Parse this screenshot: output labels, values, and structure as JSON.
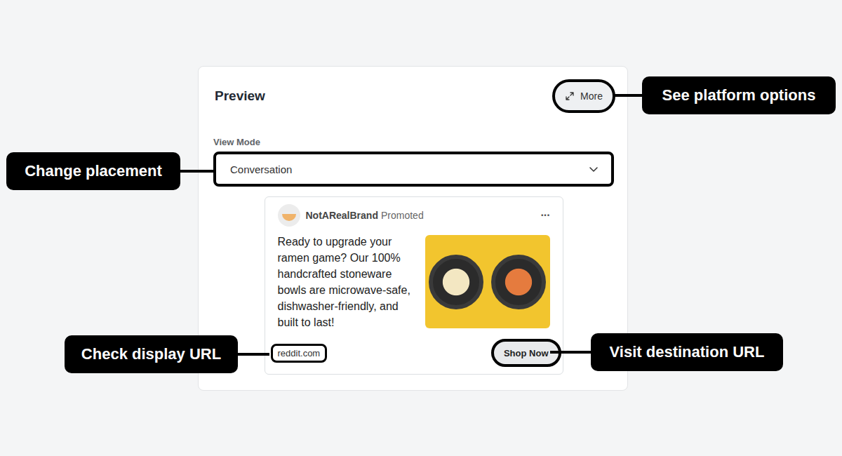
{
  "preview": {
    "title": "Preview",
    "more_button": "More",
    "view_mode_label": "View Mode",
    "view_mode_value": "Conversation"
  },
  "ad": {
    "brand": "NotARealBrand",
    "tag": "Promoted",
    "menu": "···",
    "body": "Ready to upgrade your ramen game? Our 100% handcrafted stoneware bowls are microwave-safe, dishwasher-friendly, and built to last!",
    "display_url": "reddit.com",
    "cta": "Shop Now"
  },
  "annotations": [
    {
      "label": "See platform options",
      "target": "more"
    },
    {
      "label": "Change placement",
      "target": "view-mode"
    },
    {
      "label": "Check display URL",
      "target": "display-url"
    },
    {
      "label": "Visit destination URL",
      "target": "cta"
    }
  ]
}
